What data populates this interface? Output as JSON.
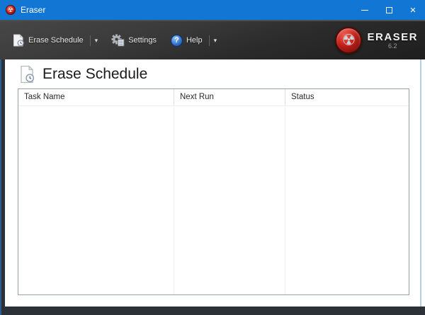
{
  "titlebar": {
    "title": "Eraser"
  },
  "toolbar": {
    "erase_schedule_label": "Erase Schedule",
    "settings_label": "Settings",
    "help_label": "Help"
  },
  "brand": {
    "name": "ERASER",
    "version": "6.2"
  },
  "content": {
    "heading": "Erase Schedule",
    "table": {
      "columns": [
        "Task Name",
        "Next Run",
        "Status"
      ],
      "rows": []
    }
  },
  "icons": {
    "radiation_glyph": "☢",
    "question_glyph": "?",
    "dropdown_glyph": "▾",
    "close_glyph": "×"
  },
  "colors": {
    "titlebar_blue": "#1176d4",
    "toolbar_dark": "#2c2c2c",
    "frame_dark": "#2b3138",
    "brand_red": "#c32018",
    "help_blue": "#3a78d0"
  }
}
